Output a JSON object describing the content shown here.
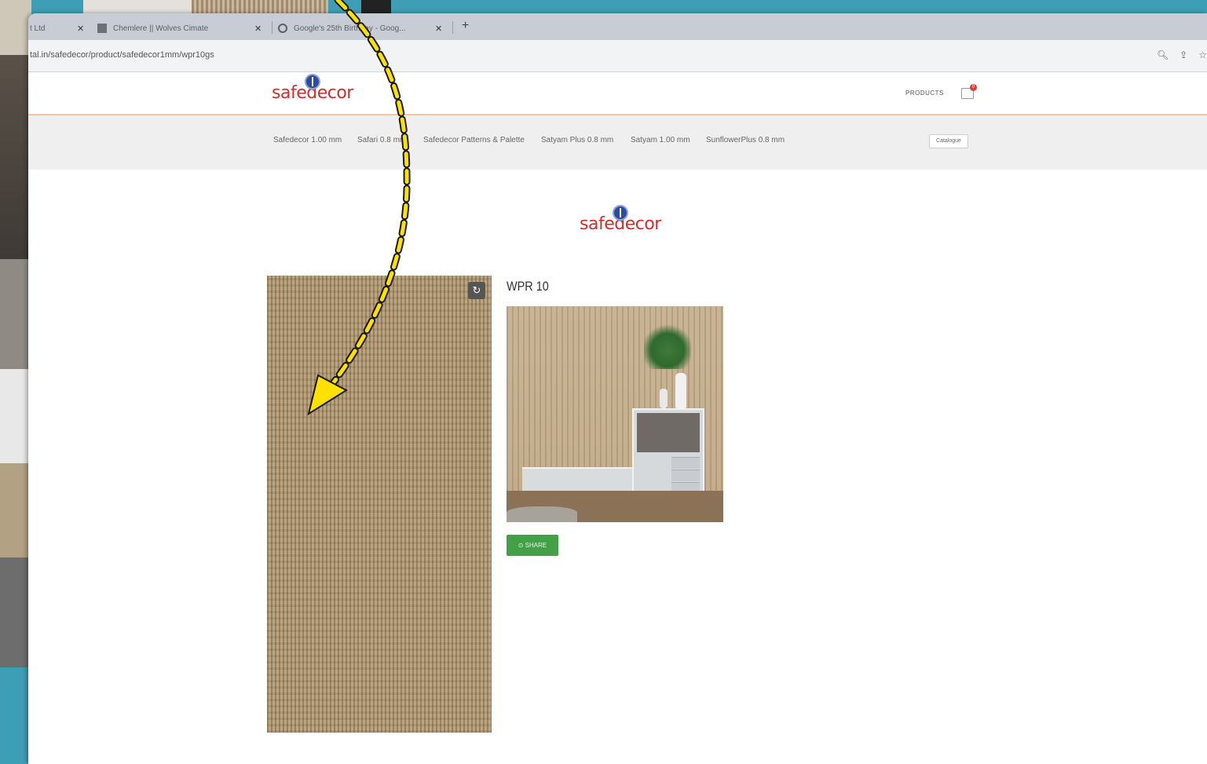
{
  "browser": {
    "tabs": [
      {
        "label": "t Ltd"
      },
      {
        "label": "Chemlere || Wolves Cimate"
      },
      {
        "label": "Google's 25th Birthday - Goog..."
      }
    ],
    "new_tab": "+",
    "url": "tal.in/safedecor/product/safedecor1mm/wpr10gs"
  },
  "site": {
    "brand": "safedecor",
    "nav_products": "PRODUCTS",
    "cart_count": "0",
    "categories": [
      "Safedecor 1.00 mm",
      "Safari 0.8 mm",
      "Safedecor Patterns & Palette",
      "Satyam Plus 0.8 mm",
      "Satyam 1.00 mm",
      "SunflowerPlus 0.8 mm"
    ],
    "catalogue": "Catalogue"
  },
  "product": {
    "title": "WPR 10",
    "share_label": "⊙ SHARE"
  },
  "colors": {
    "accent_green": "#43a047",
    "brand_red": "#d62b2b",
    "brand_blue": "#2b4aa0",
    "arrow_yellow": "#ffe100"
  }
}
